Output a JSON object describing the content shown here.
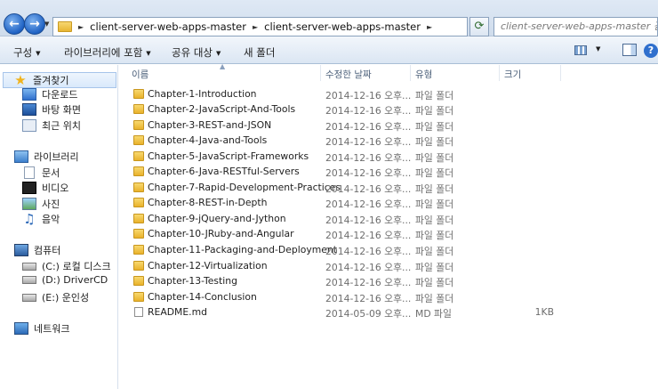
{
  "address": {
    "breadcrumbs": [
      "client-server-web-apps-master",
      "client-server-web-apps-master"
    ],
    "search_placeholder": "client-server-web-apps-master 검색"
  },
  "toolbar": {
    "organize": "구성",
    "include_library": "라이브러리에 포함",
    "share": "공유 대상",
    "new_folder": "새 폴더"
  },
  "nav": {
    "favorites": "즐겨찾기",
    "downloads": "다운로드",
    "desktop": "바탕 화면",
    "recent": "최근 위치",
    "libraries": "라이브러리",
    "documents": "문서",
    "videos": "비디오",
    "pictures": "사진",
    "music": "음악",
    "computer": "컴퓨터",
    "drive_c": "(C:) 로컬 디스크",
    "drive_d": "(D:) DriverCD",
    "drive_e": "(E:) 운인성",
    "network": "네트워크"
  },
  "columns": {
    "name": "이름",
    "date": "수정한 날짜",
    "type": "유형",
    "size": "크기"
  },
  "files": [
    {
      "name": "Chapter-1-Introduction",
      "date": "2014-12-16 오후...",
      "type": "파일 폴더",
      "size": "",
      "kind": "folder"
    },
    {
      "name": "Chapter-2-JavaScript-And-Tools",
      "date": "2014-12-16 오후...",
      "type": "파일 폴더",
      "size": "",
      "kind": "folder"
    },
    {
      "name": "Chapter-3-REST-and-JSON",
      "date": "2014-12-16 오후...",
      "type": "파일 폴더",
      "size": "",
      "kind": "folder"
    },
    {
      "name": "Chapter-4-Java-and-Tools",
      "date": "2014-12-16 오후...",
      "type": "파일 폴더",
      "size": "",
      "kind": "folder"
    },
    {
      "name": "Chapter-5-JavaScript-Frameworks",
      "date": "2014-12-16 오후...",
      "type": "파일 폴더",
      "size": "",
      "kind": "folder"
    },
    {
      "name": "Chapter-6-Java-RESTful-Servers",
      "date": "2014-12-16 오후...",
      "type": "파일 폴더",
      "size": "",
      "kind": "folder"
    },
    {
      "name": "Chapter-7-Rapid-Development-Practices",
      "date": "2014-12-16 오후...",
      "type": "파일 폴더",
      "size": "",
      "kind": "folder"
    },
    {
      "name": "Chapter-8-REST-in-Depth",
      "date": "2014-12-16 오후...",
      "type": "파일 폴더",
      "size": "",
      "kind": "folder"
    },
    {
      "name": "Chapter-9-jQuery-and-Jython",
      "date": "2014-12-16 오후...",
      "type": "파일 폴더",
      "size": "",
      "kind": "folder"
    },
    {
      "name": "Chapter-10-JRuby-and-Angular",
      "date": "2014-12-16 오후...",
      "type": "파일 폴더",
      "size": "",
      "kind": "folder"
    },
    {
      "name": "Chapter-11-Packaging-and-Deployment",
      "date": "2014-12-16 오후...",
      "type": "파일 폴더",
      "size": "",
      "kind": "folder"
    },
    {
      "name": "Chapter-12-Virtualization",
      "date": "2014-12-16 오후...",
      "type": "파일 폴더",
      "size": "",
      "kind": "folder"
    },
    {
      "name": "Chapter-13-Testing",
      "date": "2014-12-16 오후...",
      "type": "파일 폴더",
      "size": "",
      "kind": "folder"
    },
    {
      "name": "Chapter-14-Conclusion",
      "date": "2014-12-16 오후...",
      "type": "파일 폴더",
      "size": "",
      "kind": "folder"
    },
    {
      "name": "README.md",
      "date": "2014-05-09 오후...",
      "type": "MD 파일",
      "size": "1KB",
      "kind": "file"
    }
  ],
  "colors": {
    "accent": "#2f6fcd",
    "folder": "#e9b22b"
  }
}
